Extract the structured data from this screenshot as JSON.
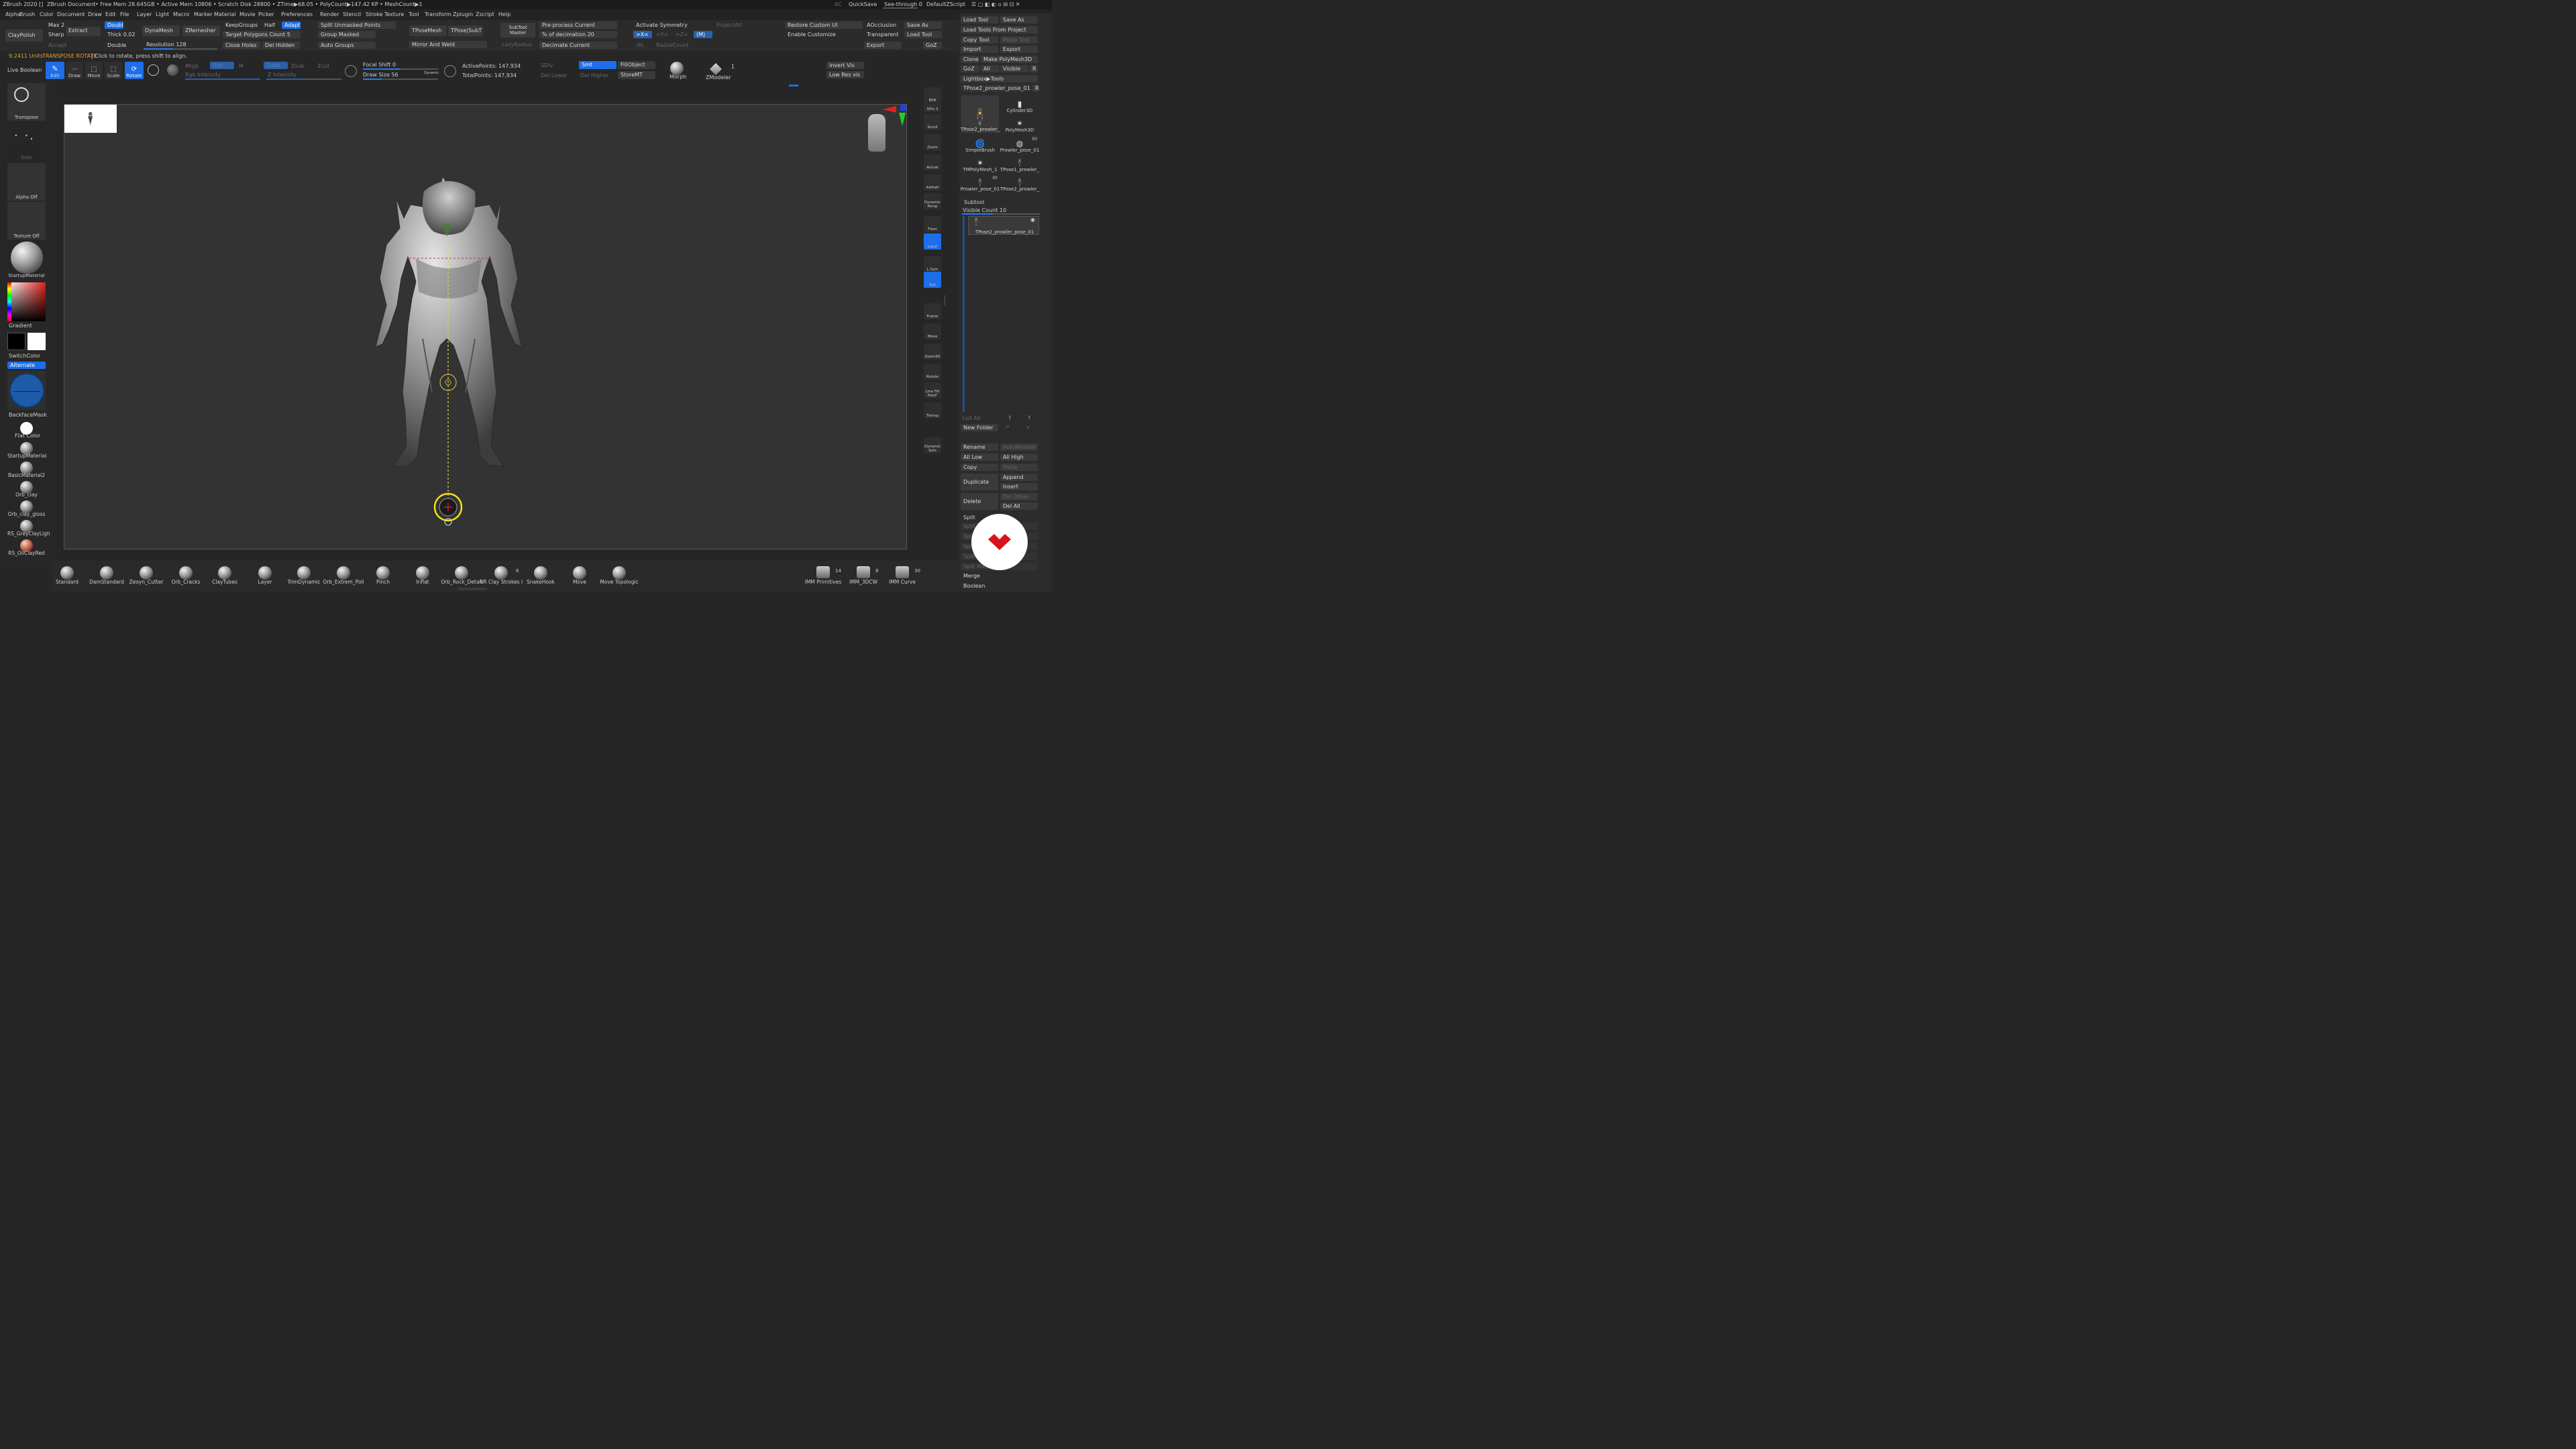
{
  "titlebar": {
    "app": "ZBrush 2020 []",
    "doc": "ZBrush Document",
    "stats": "• Free Mem 28.645GB • Active Mem 10806 • Scratch Disk 28800 • ZTime▶68.05 • PolyCount▶147.42 KP • MeshCount▶1",
    "ac": "AC",
    "quicksave": "QuickSave",
    "seethrough": "See-through  0",
    "script": "DefaultZScript"
  },
  "menu": [
    "Alpha",
    "Brush",
    "Color",
    "Document",
    "Draw",
    "Edit",
    "File",
    "Layer",
    "Light",
    "Macro",
    "Marker",
    "Material",
    "Movie",
    "Picker",
    "Preferences",
    "Render",
    "Stencil",
    "Stroke",
    "Texture",
    "Tool",
    "Transform",
    "Zplugin",
    "Zscript",
    "Help"
  ],
  "top": {
    "claypolish": "ClayPolish",
    "max": "Max 25",
    "sharp": "Sharp",
    "accept": "Accept",
    "extract": "Extract",
    "double1": "Double",
    "thick": "Thick 0.02",
    "double2": "Double",
    "dynamesh": "DynaMesh",
    "zremesher": "ZRemesher",
    "resolution": "Resolution 128",
    "keepgroups": "KeepGroups",
    "half": "Half",
    "adapt": "Adapt",
    "target": "Target Polygons Count 5",
    "closeholes": "Close Holes",
    "delhidden": "Del Hidden",
    "splitunmasked": "Split Unmasked Points",
    "groupmasked": "Group Masked",
    "autogroups": "Auto Groups",
    "tposemesh": "TPoseMesh",
    "tposesubt": "TPose|SubT",
    "mirrorweld": "Mirror And Weld",
    "subtoolmaster": "SubTool Master",
    "lazyradius": "LazyRadius",
    "preprocess": "Pre-process Current",
    "decimation": "% of decimation 20",
    "decimate": "Decimate Current",
    "activatesym": "Activate Symmetry",
    "projectall": "ProjectAll",
    "symx": ">X<",
    "symy": ">Y<",
    "symz": ">Z<",
    "symm": "(M)",
    "symr": "(R)",
    "radialcount": "RadialCount",
    "restoreui": "Restore Custom UI",
    "enablecustom": "Enable Customize",
    "aocclusion": "AOcclusion",
    "transparent": "Transparent",
    "export": "Export",
    "saveas": "Save As",
    "loadtool": "Load Tool",
    "goz": "GoZ"
  },
  "info": {
    "units": "9.2411 Units",
    "mode": "TRANSPOSE ROTATE",
    "hint": "| Click to rotate, press shift to align."
  },
  "toolbar2": {
    "liveboolean": "Live Boolean",
    "edit": "Edit",
    "draw": "Draw",
    "move": "Move",
    "scale": "Scale",
    "rotate": "Rotate",
    "mrgb": "Mrgb",
    "rgb": "Rgb",
    "m": "M",
    "rgbint": "Rgb Intensity",
    "zadd": "Zadd",
    "zsub": "Zsub",
    "zcut": "Zcut",
    "zint": "Z Intensity",
    "focal": "Focal Shift 0",
    "drawsize": "Draw Size 56",
    "dynamic": "Dynamic",
    "active": "ActivePoints: 147,934",
    "total": "TotalPoints: 147,934",
    "sdiv": "SDiv",
    "smt": "Smt",
    "dellower": "Del Lower",
    "delhigher": "Del Higher",
    "fillobject": "FillObject",
    "storemt": "StoreMT",
    "morph": "Morph",
    "zmodeler": "ZModeler",
    "zmod_n": "1",
    "invertvis": "Invert Vis",
    "lowres": "Low Res vis"
  },
  "left": {
    "transpose": "Transpose",
    "dots": "Dots",
    "alpha": "Alpha Off",
    "texture": "Texture Off",
    "startup": "StartupMaterial",
    "gradient": "Gradient",
    "switchcolor": "SwitchColor",
    "alternate": "Alternate",
    "backface": "BackfaceMask",
    "flatcolor": "Flat Color",
    "mats": [
      "StartupMaterial",
      "BasicMaterial2",
      "Orb_clay",
      "Orb_clay_gloss",
      "RS_GreyClayLigh",
      "RS_OilClayRed"
    ]
  },
  "rightnav": [
    "BPR",
    "SPix 3",
    "Scroll",
    "Zoom",
    "Actual",
    "AAHalf",
    "Dynamic Persp",
    "Floor",
    "Local",
    "L.Sym",
    "Xyz",
    "Frame",
    "Move",
    "Zoom3D",
    "Rotate",
    "Line Fill PolyF",
    "Transp",
    "Dynamic Solo"
  ],
  "toolpanel": {
    "loadtool": "Load Tool",
    "saveas": "Save As",
    "loadfromproject": "Load Tools From Project",
    "copytool": "Copy Tool",
    "pastetool": "Paste Tool",
    "import": "Import",
    "export": "Export",
    "clone": "Clone",
    "makepoly": "Make PolyMesh3D",
    "goz": "GoZ",
    "all": "All",
    "visible": "Visible",
    "r": "R",
    "lightbox": "Lightbox▶Tools",
    "current": "TPose2_prowler_pose_01. 52",
    "r2": "R",
    "thumbs": [
      {
        "label": "TPose2_prowler_",
        "n": ""
      },
      {
        "label": "Cylinder3D",
        "n": ""
      },
      {
        "label": "PolyMesh3D",
        "n": ""
      },
      {
        "label": "SimpleBrush",
        "n": ""
      },
      {
        "label": "Prowler_pose_01",
        "n": "30"
      },
      {
        "label": "TMPolyMesh_1",
        "n": ""
      },
      {
        "label": "TPose1_prowler_",
        "n": ""
      },
      {
        "label": "Prowler_pose_01",
        "n": "30"
      },
      {
        "label": "TPose2_prowler_",
        "n": ""
      }
    ],
    "subtool": "Subtool",
    "visiblecount": "Visible Count 10",
    "subtoolname": "TPose2_prowler_pose_01",
    "listall": "List All",
    "newfolder": "New Folder",
    "rename": "Rename",
    "autoreorder": "AutoReorder",
    "alllow": "All Low",
    "allhigh": "All High",
    "copy": "Copy",
    "paste": "Paste",
    "duplicate": "Duplicate",
    "append": "Append",
    "insert": "Insert",
    "delete": "Delete",
    "delother": "Del Other",
    "delall": "Del All",
    "split": "Split",
    "splits": [
      "Split Hi",
      "Split",
      "Split",
      "Split",
      "Split Mask"
    ],
    "merge": "Merge",
    "boolean": "Boolean"
  },
  "brushes": [
    {
      "label": "Standard",
      "n": ""
    },
    {
      "label": "DamStandard",
      "n": ""
    },
    {
      "label": "Zeoyn_Cutter",
      "n": ""
    },
    {
      "label": "Orb_Cracks",
      "n": ""
    },
    {
      "label": "ClayTubes",
      "n": ""
    },
    {
      "label": "Layer",
      "n": ""
    },
    {
      "label": "TrimDynamic",
      "n": ""
    },
    {
      "label": "Orb_Extrem_Poli",
      "n": ""
    },
    {
      "label": "Pinch",
      "n": ""
    },
    {
      "label": "Inflat",
      "n": ""
    },
    {
      "label": "Orb_Rock_Detail",
      "n": ""
    },
    {
      "label": "NR Clay Strokes I",
      "n": "6"
    },
    {
      "label": "SnakeHook",
      "n": ""
    },
    {
      "label": "Move",
      "n": ""
    },
    {
      "label": "Move Topologic",
      "n": ""
    }
  ],
  "imm": [
    {
      "label": "IMM Primitives",
      "n": "14"
    },
    {
      "label": "IMM_3DCW",
      "n": "8"
    },
    {
      "label": "IMM Curve",
      "n": "30"
    }
  ],
  "colors": {
    "accent": "#1d6ee8",
    "bg": "#262626",
    "panel": "#2f2f2f",
    "ring": "#f2e11a"
  }
}
